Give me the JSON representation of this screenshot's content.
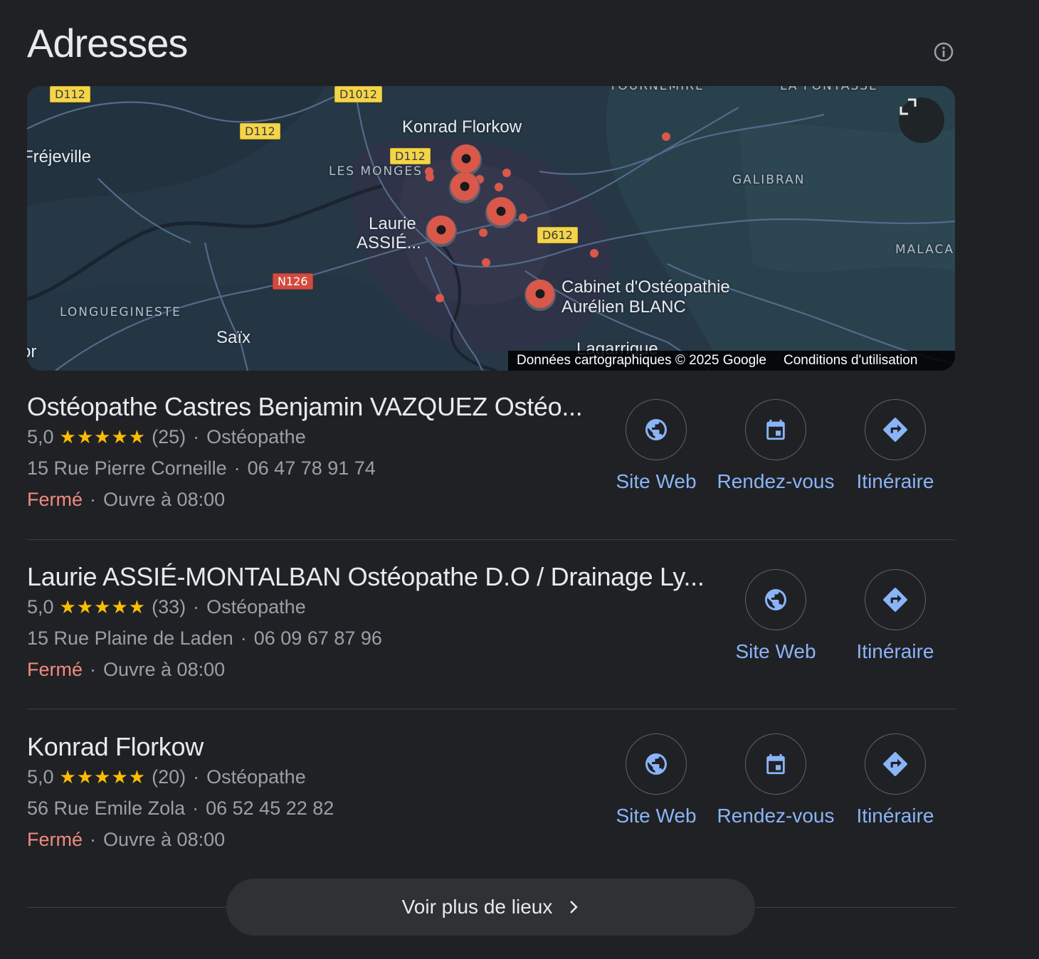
{
  "section": {
    "title": "Adresses",
    "info_icon": "info-icon"
  },
  "map": {
    "expand_icon": "expand-icon",
    "attribution": "Données cartographiques © 2025 Google",
    "terms_link": "Conditions d'utilisation",
    "labels": {
      "konrad": "Konrad Florkow",
      "laurie_line1": "Laurie",
      "laurie_line2": "ASSIÉ...",
      "cabinet_line1": "Cabinet d'Ostéopathie",
      "cabinet_line2": "Aurélien BLANC",
      "frejeville": "Fréjeville",
      "saix": "Saïx",
      "lagarrigue": "Lagarrigue",
      "les_monges": "LES MONGES",
      "galibran": "GALIBRAN",
      "malaca": "MALACA",
      "longuegineste": "LONGUEGINESTE",
      "tournemire": "TOURNEMIRE",
      "la_fontasse": "LA FONTASSE",
      "edge_or": "or"
    },
    "roads": {
      "d112_a": "D112",
      "d1012": "D1012",
      "d112_b": "D112",
      "d112_c": "D112",
      "d612": "D612",
      "n126": "N126"
    }
  },
  "places": [
    {
      "name": "Ostéopathe Castres Benjamin VAZQUEZ Ostéo...",
      "rating": "5,0",
      "stars": "★★★★★",
      "reviews": "(25)",
      "category": "Ostéopathe",
      "address": "15 Rue Pierre Corneille",
      "phone": "06 47 78 91 74",
      "status": "Fermé",
      "opens": "Ouvre à 08:00",
      "actions": {
        "website": "Site Web",
        "appointment": "Rendez-vous",
        "directions": "Itinéraire"
      }
    },
    {
      "name": "Laurie ASSIÉ-MONTALBAN Ostéopathe D.O / Drainage Ly...",
      "rating": "5,0",
      "stars": "★★★★★",
      "reviews": "(33)",
      "category": "Ostéopathe",
      "address": "15 Rue Plaine de Laden",
      "phone": "06 09 67 87 96",
      "status": "Fermé",
      "opens": "Ouvre à 08:00",
      "actions": {
        "website": "Site Web",
        "directions": "Itinéraire"
      }
    },
    {
      "name": "Konrad Florkow",
      "rating": "5,0",
      "stars": "★★★★★",
      "reviews": "(20)",
      "category": "Ostéopathe",
      "address": "56 Rue Emile Zola",
      "phone": "06 52 45 22 82",
      "status": "Fermé",
      "opens": "Ouvre à 08:00",
      "actions": {
        "website": "Site Web",
        "appointment": "Rendez-vous",
        "directions": "Itinéraire"
      }
    }
  ],
  "separator": "·",
  "more_button": {
    "label": "Voir plus de lieux",
    "icon": "chevron-right-icon"
  },
  "colors": {
    "background": "#202124",
    "link": "#8ab4f8",
    "stars": "#fbbc04",
    "closed": "#f28b82",
    "pin": "#d9584a"
  }
}
